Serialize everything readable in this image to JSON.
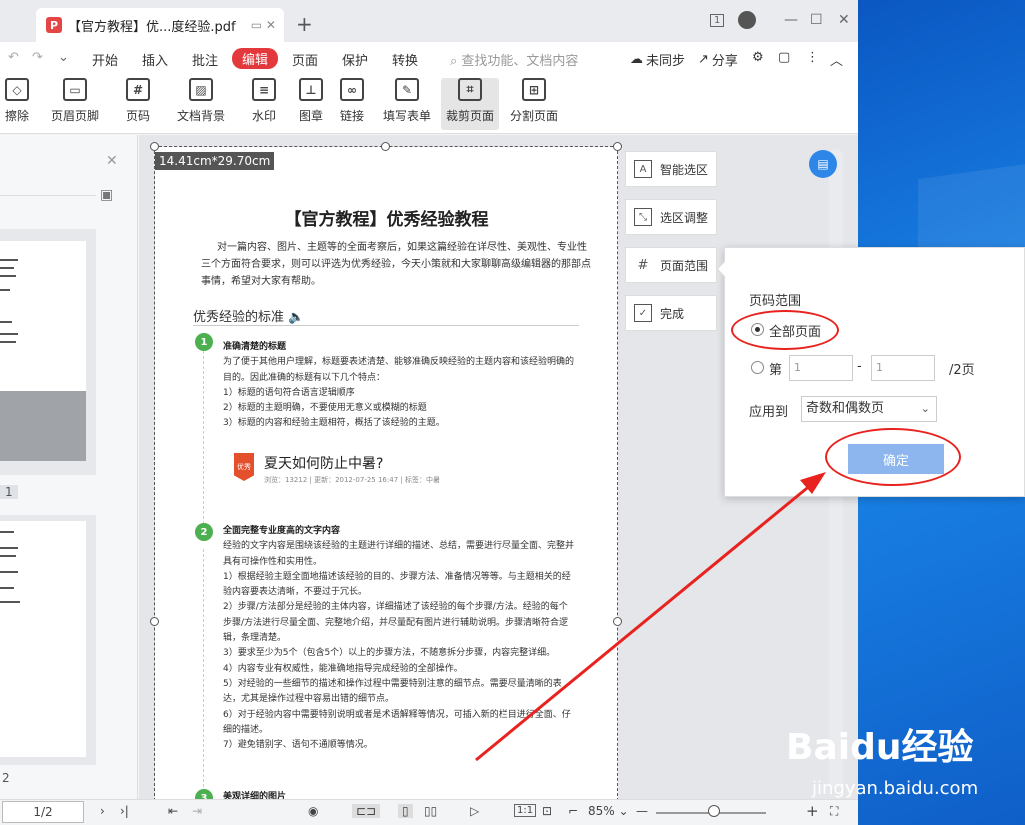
{
  "window": {
    "tab_title": "【官方教程】优...度经验.pdf",
    "tab_icon": "P",
    "new_tab": "+",
    "page_badge": "1"
  },
  "menu": {
    "items": [
      "开始",
      "插入",
      "批注",
      "编辑",
      "页面",
      "保护",
      "转换"
    ],
    "active": "编辑",
    "search_placeholder": "查找功能、文档内容",
    "sync": "未同步",
    "share": "分享"
  },
  "toolbar": {
    "tools": [
      {
        "label": "擦除",
        "icon": "◇"
      },
      {
        "label": "页眉页脚",
        "icon": "▭"
      },
      {
        "label": "页码",
        "icon": "#"
      },
      {
        "label": "文档背景",
        "icon": "▨"
      },
      {
        "label": "水印",
        "icon": "≡"
      },
      {
        "label": "图章",
        "icon": "⊥"
      },
      {
        "label": "链接",
        "icon": "∞"
      },
      {
        "label": "填写表单",
        "icon": "✎"
      },
      {
        "label": "裁剪页面",
        "icon": "⌗"
      },
      {
        "label": "分割页面",
        "icon": "⊞"
      }
    ],
    "selected": "裁剪页面"
  },
  "sidebar": {
    "page_labels": [
      "1",
      "2"
    ]
  },
  "document": {
    "dimension": "14.41cm*29.70cm",
    "title": "【官方教程】优秀经验教程",
    "intro": "对一篇内容、图片、主题等的全面考察后，如果这篇经验在详尽性、美观性、专业性三个方面符合要求，则可以评选为优秀经验，今天小策就和大家聊聊高级编辑器的那部点事情，希望对大家有帮助。",
    "section": "优秀经验的标准",
    "step1_num": "1",
    "step1_title": "准确清楚的标题",
    "step1_lines": [
      "为了便于其他用户理解，标题要表述清楚、能够准确反映经验的主题内容和该经验明确的",
      "目的。因此准确的标题有以下几个特点：",
      "1）标题的语句符合语言逻辑顺序",
      "2）标题的主题明确，不要使用无意义或模糊的标题",
      "3）标题的内容和经验主题相符，概括了该经验的主题。"
    ],
    "card_title": "夏天如何防止中暑?",
    "card_badge": "优秀",
    "card_meta": "浏览：13212 | 更新：2012-07-25 16:47 | 标签：中暑",
    "step2_num": "2",
    "step2_title": "全面完整专业度高的文字内容",
    "step2_lines": [
      "经验的文字内容是围绕该经验的主题进行详细的描述、总结，需要进行尽量全面、完整并",
      "具有可操作性和实用性。",
      "1）根据经验主题全面地描述该经验的目的、步骤方法、准备情况等等。与主题相关的经",
      "验内容要表达清晰，不要过于冗长。",
      "2）步骤/方法部分是经验的主体内容，详细描述了该经验的每个步骤/方法。经验的每个",
      "步骤/方法进行尽量全面、完整地介绍，并尽量配有图片进行辅助说明。步骤清晰符合逻",
      "辑，条理清楚。",
      "3）要求至少为5个（包含5个）以上的步骤方法，不随意拆分步骤，内容完整详细。",
      "4）内容专业有权威性，能准确地指导完成经验的全部操作。",
      "5）对经验的一些细节的描述和操作过程中需要特别注意的细节点。需要尽量清晰的表",
      "达，尤其是操作过程中容易出错的细节点。",
      "6）对于经验内容中需要特别说明或者是术语解释等情况，可插入新的栏目进行全面、仔",
      "细的描述。",
      "7）避免错别字、语句不通顺等情况。"
    ],
    "step3_num": "3",
    "step3_title": "美观详细的图片"
  },
  "panel": {
    "smart": "智能选区",
    "adjust": "选区调整",
    "range": "页面范围",
    "done": "完成"
  },
  "popup": {
    "title": "页码范围",
    "all_pages": "全部页面",
    "page_prefix": "第",
    "from_placeholder": "1",
    "dash": "-",
    "to_placeholder": "1",
    "total": "/2页",
    "apply_label": "应用到",
    "apply_value": "奇数和偶数页",
    "confirm": "确定"
  },
  "status": {
    "page_field": "1/2",
    "zoom": "85%"
  },
  "watermark": {
    "brand": "Baidu经验",
    "url": "jingyan.baidu.com"
  },
  "colors": {
    "accent_red": "#e4393c",
    "annotation_red": "#e8231f",
    "confirm_blue": "#8db6ee",
    "step_green": "#4caf50"
  }
}
